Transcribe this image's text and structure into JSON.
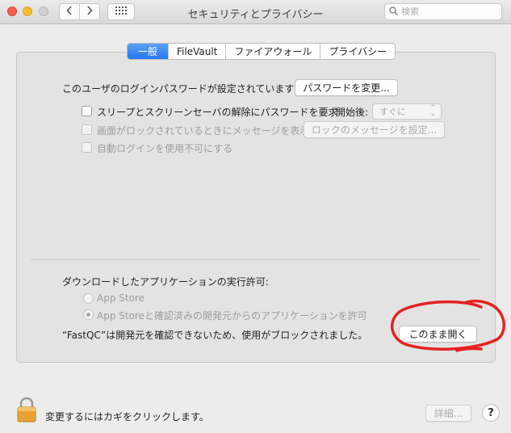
{
  "window": {
    "title": "セキュリティとプライバシー",
    "search_placeholder": "検索"
  },
  "tabs": [
    {
      "label": "一般",
      "active": true
    },
    {
      "label": "FileVault",
      "active": false
    },
    {
      "label": "ファイアウォール",
      "active": false
    },
    {
      "label": "プライバシー",
      "active": false
    }
  ],
  "general": {
    "password_set_text": "このユーザのログインパスワードが設定されています",
    "change_password_button": "パスワードを変更...",
    "require_password_label": "スリープとスクリーンセーバの解除にパスワードを要求",
    "start_label": "開始後:",
    "start_value": "すぐに",
    "lock_message_label": "画面がロックされているときにメッセージを表示",
    "set_lock_message_button": "ロックのメッセージを設定...",
    "disable_autologin_label": "自動ログインを使用不可にする"
  },
  "downloads": {
    "heading": "ダウンロードしたアプリケーションの実行許可:",
    "option_app_store": "App Store",
    "option_app_store_identified": "App Storeと確認済みの開発元からのアプリケーションを許可",
    "blocked_message": "“FastQC”は開発元を確認できないため、使用がブロックされました。",
    "open_anyway_button": "このまま開く"
  },
  "footer": {
    "lock_text": "変更するにはカギをクリックします。",
    "advanced_button": "詳細...",
    "help_label": "?"
  },
  "colors": {
    "tab_active": "#2775ee",
    "annotation": "#e52222"
  }
}
